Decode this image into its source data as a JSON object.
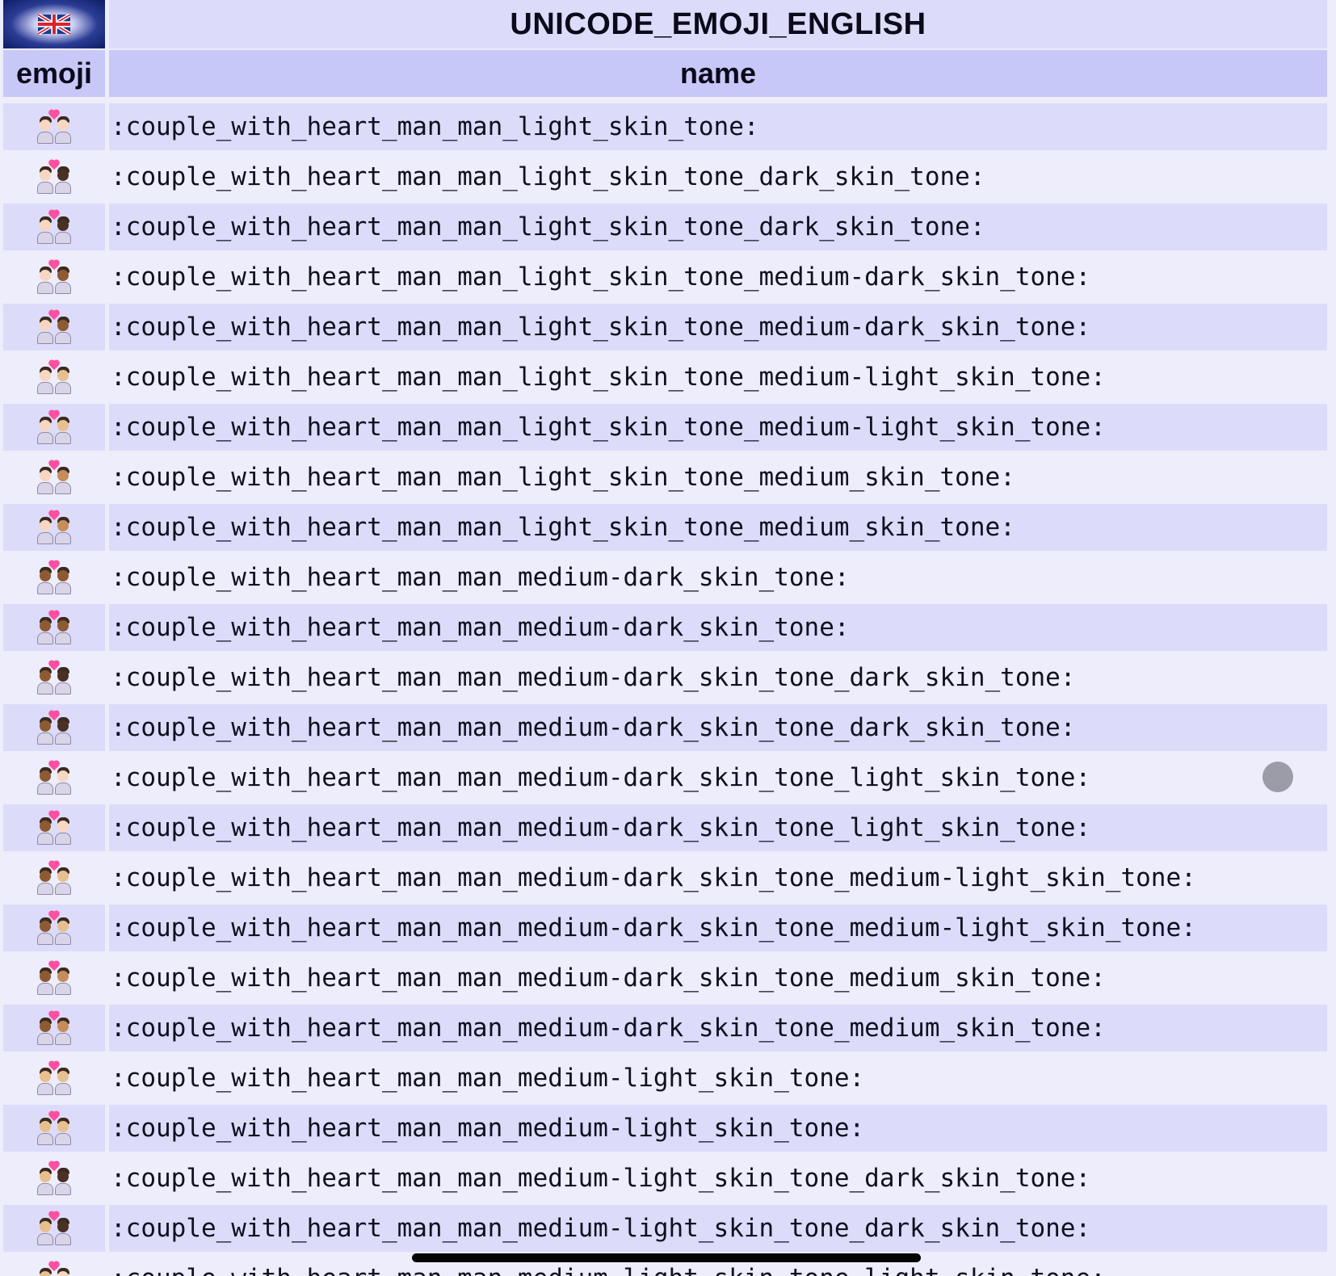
{
  "title": "UNICODE_EMOJI_ENGLISH",
  "flag_icon": "uk-flag-icon",
  "columns": {
    "emoji": "emoji",
    "name": "name"
  },
  "skin_colors": {
    "light": "#f7d7c2",
    "medium-light": "#e8bf8f",
    "medium": "#c68d5b",
    "medium-dark": "#8d5a34",
    "dark": "#4a3124"
  },
  "rows": [
    {
      "name": ":couple_with_heart_man_man_light_skin_tone:",
      "left": "light",
      "right": "light"
    },
    {
      "name": ":couple_with_heart_man_man_light_skin_tone_dark_skin_tone:",
      "left": "light",
      "right": "dark"
    },
    {
      "name": ":couple_with_heart_man_man_light_skin_tone_dark_skin_tone:",
      "left": "light",
      "right": "dark"
    },
    {
      "name": ":couple_with_heart_man_man_light_skin_tone_medium-dark_skin_tone:",
      "left": "light",
      "right": "medium-dark"
    },
    {
      "name": ":couple_with_heart_man_man_light_skin_tone_medium-dark_skin_tone:",
      "left": "light",
      "right": "medium-dark"
    },
    {
      "name": ":couple_with_heart_man_man_light_skin_tone_medium-light_skin_tone:",
      "left": "light",
      "right": "medium-light"
    },
    {
      "name": ":couple_with_heart_man_man_light_skin_tone_medium-light_skin_tone:",
      "left": "light",
      "right": "medium-light"
    },
    {
      "name": ":couple_with_heart_man_man_light_skin_tone_medium_skin_tone:",
      "left": "light",
      "right": "medium"
    },
    {
      "name": ":couple_with_heart_man_man_light_skin_tone_medium_skin_tone:",
      "left": "light",
      "right": "medium"
    },
    {
      "name": ":couple_with_heart_man_man_medium-dark_skin_tone:",
      "left": "medium-dark",
      "right": "medium-dark"
    },
    {
      "name": ":couple_with_heart_man_man_medium-dark_skin_tone:",
      "left": "medium-dark",
      "right": "medium-dark"
    },
    {
      "name": ":couple_with_heart_man_man_medium-dark_skin_tone_dark_skin_tone:",
      "left": "medium-dark",
      "right": "dark"
    },
    {
      "name": ":couple_with_heart_man_man_medium-dark_skin_tone_dark_skin_tone:",
      "left": "medium-dark",
      "right": "dark"
    },
    {
      "name": ":couple_with_heart_man_man_medium-dark_skin_tone_light_skin_tone:",
      "left": "medium-dark",
      "right": "light"
    },
    {
      "name": ":couple_with_heart_man_man_medium-dark_skin_tone_light_skin_tone:",
      "left": "medium-dark",
      "right": "light"
    },
    {
      "name": ":couple_with_heart_man_man_medium-dark_skin_tone_medium-light_skin_tone:",
      "left": "medium-dark",
      "right": "medium-light"
    },
    {
      "name": ":couple_with_heart_man_man_medium-dark_skin_tone_medium-light_skin_tone:",
      "left": "medium-dark",
      "right": "medium-light"
    },
    {
      "name": ":couple_with_heart_man_man_medium-dark_skin_tone_medium_skin_tone:",
      "left": "medium-dark",
      "right": "medium"
    },
    {
      "name": ":couple_with_heart_man_man_medium-dark_skin_tone_medium_skin_tone:",
      "left": "medium-dark",
      "right": "medium"
    },
    {
      "name": ":couple_with_heart_man_man_medium-light_skin_tone:",
      "left": "medium-light",
      "right": "medium-light"
    },
    {
      "name": ":couple_with_heart_man_man_medium-light_skin_tone:",
      "left": "medium-light",
      "right": "medium-light"
    },
    {
      "name": ":couple_with_heart_man_man_medium-light_skin_tone_dark_skin_tone:",
      "left": "medium-light",
      "right": "dark"
    },
    {
      "name": ":couple_with_heart_man_man_medium-light_skin_tone_dark_skin_tone:",
      "left": "medium-light",
      "right": "dark"
    },
    {
      "name": ":couple_with_heart_man_man_medium-light_skin_tone_light_skin_tone:",
      "left": "medium-light",
      "right": "light"
    }
  ]
}
